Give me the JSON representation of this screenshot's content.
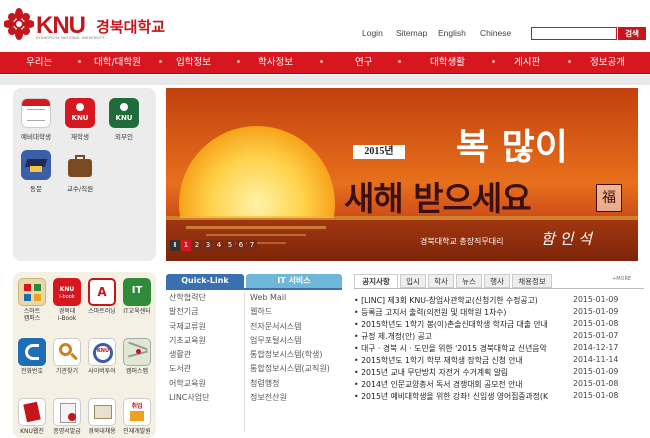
{
  "header": {
    "logo_text": "KNU",
    "logo_korean": "경북대학교",
    "logo_sub": "KYUNGPOOK NATIONAL UNIVERSITY",
    "utility_links": [
      "Login",
      "Sitemap",
      "English",
      "Chinese"
    ],
    "search": {
      "placeholder": "",
      "button": "검색"
    }
  },
  "nav": {
    "items": [
      "우리는",
      "대학/대학원",
      "입학정보",
      "학사정보",
      "연구",
      "대학생활",
      "게시판",
      "정보공개"
    ]
  },
  "quick_menu": {
    "items": [
      {
        "label": "예비대학생",
        "icon": "calendar-icon",
        "color": "#ffffff"
      },
      {
        "label": "재학생",
        "icon": "knu-icon",
        "color": "#d7171f"
      },
      {
        "label": "외부인",
        "icon": "knu-icon",
        "color": "#1f6b3a"
      },
      {
        "label": "동문",
        "icon": "graduation-cap-icon",
        "color": "#3a5fa8"
      },
      {
        "label": "교수/직원",
        "icon": "briefcase-icon",
        "color": "#7a4a20"
      }
    ]
  },
  "hero": {
    "year_badge": "2015년",
    "greeting_line1": "복 많이",
    "greeting_line2": "새해 받으세요",
    "seal": "福",
    "signature_label": "경북대학교 총장직무대리",
    "signature": "함 인 석",
    "pager": [
      "1",
      "2",
      "3",
      "4",
      "5",
      "6",
      "7"
    ],
    "active_page": 1
  },
  "bottom_icons": {
    "items": [
      {
        "label": "스마트\n캠퍼스",
        "icon": "smart-campus-icon",
        "color": "#e9d9a8"
      },
      {
        "label": "경북대\ni-Book",
        "icon": "ibook-icon",
        "color": "#d7171f"
      },
      {
        "label": "스마트러닝",
        "icon": "smart-learning-icon",
        "color": "#c4161c"
      },
      {
        "label": "IT교육센터",
        "icon": "it-center-icon",
        "color": "#2f8b3a"
      },
      {
        "label": "전화번호",
        "icon": "phone-icon",
        "color": "#1e6db5"
      },
      {
        "label": "기관찾기",
        "icon": "finder-icon",
        "color": "#ffffff"
      },
      {
        "label": "사이버투어",
        "icon": "cyber-tour-icon",
        "color": "#ffffff"
      },
      {
        "label": "캠퍼스맵",
        "icon": "map-icon",
        "color": "#ffffff"
      },
      {
        "label": "KNU웹진",
        "icon": "webzine-icon",
        "color": "#ffffff"
      },
      {
        "label": "증명서발급",
        "icon": "certificate-icon",
        "color": "#ffffff"
      },
      {
        "label": "경북대채용",
        "icon": "recruit-icon",
        "color": "#ffffff"
      },
      {
        "label": "인재개발원",
        "icon": "talent-icon",
        "color": "#ffffff"
      }
    ]
  },
  "quick_link": {
    "tab_label": "Quick-Link",
    "items": [
      "산학협력단",
      "발전기금",
      "국제교류원",
      "기초교육원",
      "생활관",
      "도서관",
      "어학교육원",
      "LINC사업단"
    ]
  },
  "it_services": {
    "tab_label": "IT 서비스",
    "items": [
      "Web Mail",
      "웹하드",
      "전자문서시스템",
      "업무포털시스템",
      "통합정보시스템(학생)",
      "통합정보시스템(교직원)",
      "청렴행정",
      "정보전산원"
    ]
  },
  "news": {
    "tabs": [
      "공지사항",
      "입시",
      "학사",
      "뉴스",
      "행사",
      "채용정보"
    ],
    "more_label": "MORE",
    "rows": [
      {
        "title": "[LINC] 제3회 KNU-창업사관학교(신청기한 수정공고)",
        "date": "2015-01-09"
      },
      {
        "title": "등록금 고지서 출력(의전원 및 대학원 1차수)",
        "date": "2015-01-09"
      },
      {
        "title": "2015학년도 1학기 봉(이)촌솔신대학생 학자금 대출 안내",
        "date": "2015-01-08"
      },
      {
        "title": "규정 제.개정(안) 공고",
        "date": "2015-01-07"
      },
      {
        "title": "대구 · 경북 시 · 도민을 위한 '2015 경북대학교 신년음악",
        "date": "2014-12-17"
      },
      {
        "title": "2015학년도 1학기 학부 재학생 장학금 신청 안내",
        "date": "2014-11-14"
      },
      {
        "title": "2015년 교내 무단방치 자전거 수거계획 알림",
        "date": "2015-01-09"
      },
      {
        "title": "2014년 인문교양총서 독서 경쟁대회 공모전 안내",
        "date": "2015-01-08"
      },
      {
        "title": "2015년 예비대학생을 위한 강좌! 신입생 영어집중과정(K",
        "date": "2015-01-08"
      }
    ]
  },
  "colors": {
    "brand_red": "#d7171f",
    "quick_link_tab": "#3a6fb0",
    "it_tab": "#6fb7d8"
  }
}
